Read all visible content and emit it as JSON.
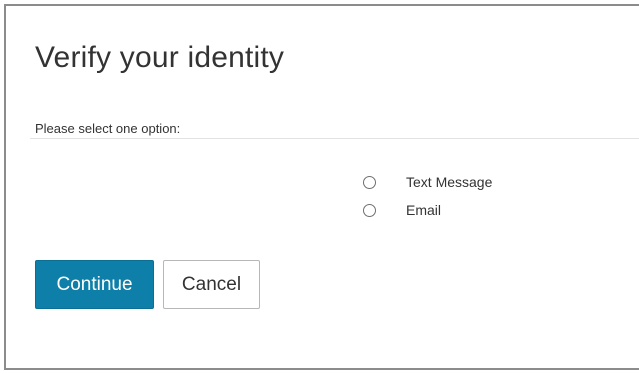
{
  "dialog": {
    "title": "Verify your identity",
    "prompt": "Please select one option:",
    "options": [
      {
        "label": "Text Message",
        "selected": false
      },
      {
        "label": "Email",
        "selected": false
      }
    ],
    "buttons": {
      "continue_label": "Continue",
      "cancel_label": "Cancel"
    }
  },
  "colors": {
    "primary_button": "#0d7fa8",
    "text": "#333333",
    "frame_border": "#8c8c8c"
  }
}
